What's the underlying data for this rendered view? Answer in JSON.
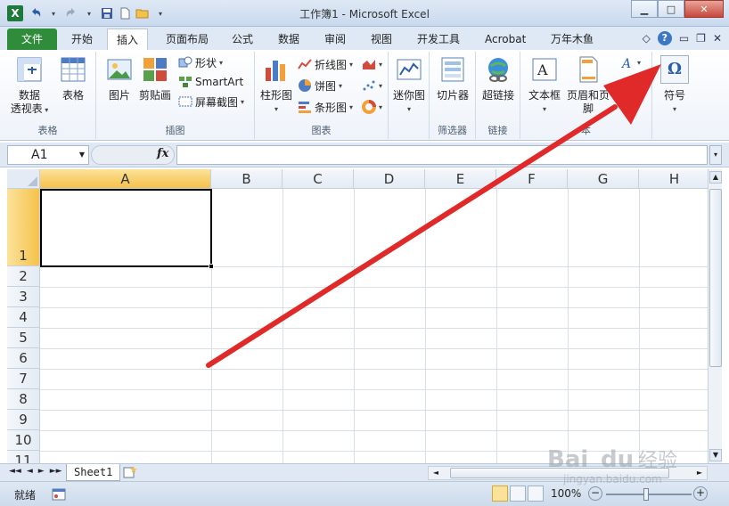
{
  "titlebar": {
    "title": "工作簿1 - Microsoft Excel",
    "app_icon_letter": "X",
    "qat_icons": [
      "undo-icon",
      "redo-icon",
      "save-icon",
      "new-icon",
      "open-icon"
    ]
  },
  "tabs": {
    "file": "文件",
    "items": [
      "开始",
      "插入",
      "页面布局",
      "公式",
      "数据",
      "审阅",
      "视图",
      "开发工具",
      "Acrobat",
      "万年木鱼"
    ],
    "active": "插入"
  },
  "ribbon": {
    "groups": {
      "tables": {
        "label": "表格",
        "pivot": "数据\n透视表",
        "pivot_line1": "数据",
        "pivot_line2": "透视表",
        "table": "表格"
      },
      "illustrations": {
        "label": "插图",
        "picture": "图片",
        "clipart": "剪贴画",
        "shapes": "形状",
        "smartart": "SmartArt",
        "screenshot": "屏幕截图"
      },
      "charts": {
        "label": "图表",
        "column": "柱形图",
        "line": "折线图",
        "pie": "饼图",
        "bar": "条形图"
      },
      "sparklines": {
        "label": "",
        "mini": "迷你图"
      },
      "filter": {
        "label": "筛选器",
        "slicer": "切片器"
      },
      "links": {
        "label": "链接",
        "hyperlink": "超链接"
      },
      "text": {
        "label": "本",
        "textbox": "文本框",
        "header": "页眉和页脚"
      },
      "symbols": {
        "symbol": "符号",
        "symbol_glyph": "Ω"
      }
    }
  },
  "formula": {
    "namebox": "A1",
    "fx": "fx",
    "value": ""
  },
  "grid": {
    "columns": [
      "A",
      "B",
      "C",
      "D",
      "E",
      "F",
      "G",
      "H"
    ],
    "rows": [
      "1",
      "2",
      "3",
      "4",
      "5",
      "6",
      "7",
      "8",
      "9",
      "10",
      "11"
    ],
    "active_cell": "A1"
  },
  "sheets": {
    "tabs": [
      "Sheet1"
    ],
    "nav": [
      "◄◄",
      "◄",
      "►",
      "►►"
    ]
  },
  "status": {
    "ready": "就绪",
    "zoom": "100%",
    "zoom_minus": "−",
    "zoom_plus": "+"
  },
  "watermark": {
    "brand": "Bai",
    "brand2": "du",
    "brand_suffix": "经验",
    "url": "jingyan.baidu.com"
  },
  "colors": {
    "file_tab": "#2f8c3b",
    "selected_header": "#f6c24a",
    "arrow": "#e02a2a"
  }
}
